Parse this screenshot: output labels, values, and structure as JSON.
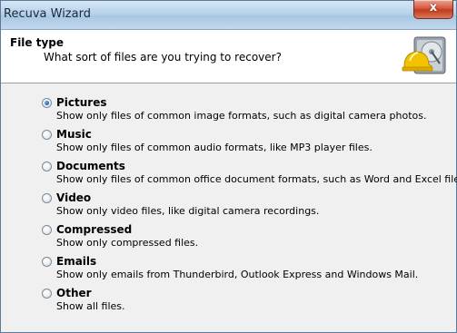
{
  "window": {
    "title": "Recuva Wizard",
    "close_label": "x"
  },
  "header": {
    "title": "File type",
    "subtitle": "What sort of files are you trying to recover?",
    "logo_icon": "recuva-logo-icon"
  },
  "options": [
    {
      "label": "Pictures",
      "description": "Show only files of common image formats, such as digital camera photos.",
      "selected": true
    },
    {
      "label": "Music",
      "description": "Show only files of common audio formats, like MP3 player files.",
      "selected": false
    },
    {
      "label": "Documents",
      "description": "Show only files of common office document formats, such as Word and Excel files.",
      "selected": false
    },
    {
      "label": "Video",
      "description": "Show only video files, like digital camera recordings.",
      "selected": false
    },
    {
      "label": "Compressed",
      "description": "Show only compressed files.",
      "selected": false
    },
    {
      "label": "Emails",
      "description": "Show only emails from Thunderbird, Outlook Express and Windows Mail.",
      "selected": false
    },
    {
      "label": "Other",
      "description": "Show all files.",
      "selected": false
    }
  ],
  "colors": {
    "header_bg": "#ffffff",
    "panel_bg": "#f0f0f0",
    "selected_radio": "#1a5fa8"
  }
}
